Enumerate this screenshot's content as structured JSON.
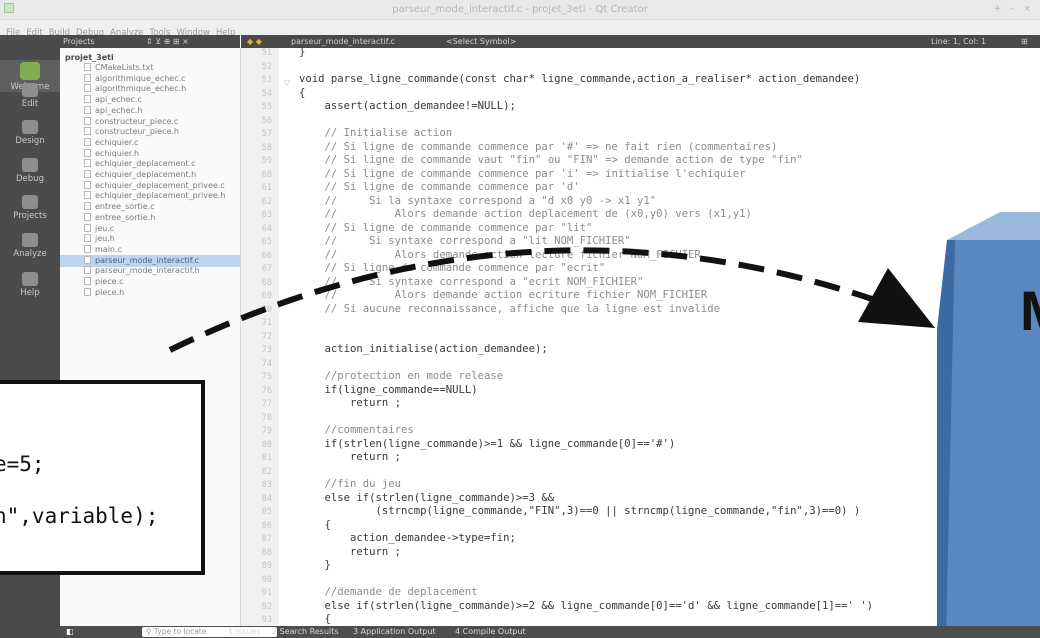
{
  "window": {
    "title": "parseur_mode_interactif.c - projet_3eti - Qt Creator",
    "buttons": "+ – ×"
  },
  "menu": [
    "File",
    "Edit",
    "Build",
    "Debug",
    "Analyze",
    "Tools",
    "Window",
    "Help"
  ],
  "modes": [
    "Welcome",
    "Edit",
    "Design",
    "Debug",
    "Projects",
    "Analyze",
    "Help"
  ],
  "projects_header": {
    "label": "Projects",
    "controls": "⇕ ⊻ ⊕ ⊞ ×"
  },
  "project": {
    "root": "projet_3eti",
    "files": [
      "CMakeLists.txt",
      "algorithmique_echec.c",
      "algorithmique_echec.h",
      "api_echec.c",
      "api_echec.h",
      "constructeur_piece.c",
      "constructeur_piece.h",
      "echiquier.c",
      "echiquier.h",
      "echiquier_deplacement.c",
      "echiquier_deplacement.h",
      "echiquier_deplacement_privee.c",
      "echiquier_deplacement_privee.h",
      "entree_sortie.c",
      "entree_sortie.h",
      "jeu.c",
      "jeu.h",
      "main.c",
      "parseur_mode_interactif.c",
      "parseur_mode_interactif.h",
      "piece.c",
      "piece.h"
    ],
    "selected": "parseur_mode_interactif.c"
  },
  "editor": {
    "file": "parseur_mode_interactif.c",
    "symbol": "<Select Symbol>",
    "position": "Line: 1, Col: 1"
  },
  "line_numbers": [
    "51",
    "52",
    "53",
    "54",
    "55",
    "56",
    "57",
    "58",
    "59",
    "60",
    "61",
    "62",
    "63",
    "64",
    "65",
    "66",
    "67",
    "68",
    "69",
    "70",
    "71",
    "72",
    "73",
    "74",
    "75",
    "76",
    "77",
    "78",
    "79",
    "80",
    "81",
    "82",
    "83",
    "84",
    "85",
    "86",
    "87",
    "88",
    "89",
    "90",
    "91",
    "92",
    "93"
  ],
  "code": [
    {
      "s": "}"
    },
    {
      "s": ""
    },
    {
      "s": "void parse_ligne_commande(const char* ligne_commande,action_a_realiser* action_demandee)"
    },
    {
      "s": "{"
    },
    {
      "s": "    assert(action_demandee!=NULL);"
    },
    {
      "s": ""
    },
    {
      "s": "    // Initialise action",
      "c": "cm"
    },
    {
      "s": "    // Si ligne de commande commence par '#' => ne fait rien (commentaires)",
      "c": "cm"
    },
    {
      "s": "    // Si ligne de commande vaut \"fin\" ou \"FIN\" => demande action de type \"fin\"",
      "c": "cm"
    },
    {
      "s": "    // Si ligne de commande commence par 'i' => initialise l'echiquier",
      "c": "cm"
    },
    {
      "s": "    // Si ligne de commande commence par 'd'",
      "c": "cm"
    },
    {
      "s": "    //     Si la syntaxe correspond a \"d x0 y0 -> x1 y1\"",
      "c": "cm"
    },
    {
      "s": "    //         Alors demande action deplacement de (x0,y0) vers (x1,y1)",
      "c": "cm"
    },
    {
      "s": "    // Si ligne de commande commence par \"lit\"",
      "c": "cm"
    },
    {
      "s": "    //     Si syntaxe correspond a \"lit NOM_FICHIER\"",
      "c": "cm"
    },
    {
      "s": "    //         Alors demande action lecture fichier NOM_FICHIER",
      "c": "cm"
    },
    {
      "s": "    // Si ligne de commande commence par \"ecrit\"",
      "c": "cm"
    },
    {
      "s": "    //     Si syntaxe correspond a \"ecrit NOM_FICHIER\"",
      "c": "cm"
    },
    {
      "s": "    //         Alors demande action ecriture fichier NOM_FICHIER",
      "c": "cm"
    },
    {
      "s": "    // Si aucune reconnaissance, affiche que la ligne est invalide",
      "c": "cm"
    },
    {
      "s": ""
    },
    {
      "s": ""
    },
    {
      "s": "    action_initialise(action_demandee);"
    },
    {
      "s": ""
    },
    {
      "s": "    //protection en mode release",
      "c": "cm"
    },
    {
      "s": "    if(ligne_commande==NULL)"
    },
    {
      "s": "        return ;"
    },
    {
      "s": ""
    },
    {
      "s": "    //commentaires",
      "c": "cm"
    },
    {
      "s": "    if(strlen(ligne_commande)>=1 && ligne_commande[0]=='#')"
    },
    {
      "s": "        return ;"
    },
    {
      "s": ""
    },
    {
      "s": "    //fin du jeu",
      "c": "cm"
    },
    {
      "s": "    else if(strlen(ligne_commande)>=3 &&"
    },
    {
      "s": "            (strncmp(ligne_commande,\"FIN\",3)==0 || strncmp(ligne_commande,\"fin\",3)==0) )"
    },
    {
      "s": "    {"
    },
    {
      "s": "        action_demandee->type=fin;"
    },
    {
      "s": "        return ;"
    },
    {
      "s": "    }"
    },
    {
      "s": ""
    },
    {
      "s": "    //demande de deplacement",
      "c": "cm"
    },
    {
      "s": "    else if(strlen(ligne_commande)>=2 && ligne_commande[0]=='d' && ligne_commande[1]==' ')"
    },
    {
      "s": "    {"
    }
  ],
  "overlay_code": [
    "e=5;",
    "n\",variable);"
  ],
  "box_text": "M",
  "statusbar": {
    "locate_placeholder": "Type to locate",
    "panes": [
      "1 Issues",
      "2 Search Results",
      "3 Application Output",
      "4 Compile Output"
    ]
  },
  "colors": {
    "sidebar": "#4b4b4b",
    "selection": "#bcd4ee",
    "box": "#5b87c0"
  }
}
